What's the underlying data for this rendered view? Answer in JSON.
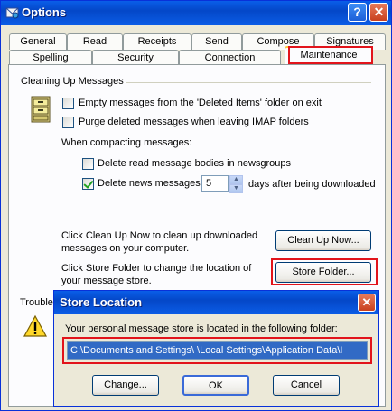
{
  "window": {
    "title": "Options",
    "help_label": "?",
    "close_label": "✕"
  },
  "tabs_row1": [
    "General",
    "Read",
    "Receipts",
    "Send",
    "Compose",
    "Signatures"
  ],
  "tabs_row2": [
    "Spelling",
    "Security",
    "Connection",
    "Maintenance"
  ],
  "selected_tab": "Maintenance",
  "cleanup": {
    "group_label": "Cleaning Up Messages",
    "empty_deleted": {
      "label": "Empty messages from the 'Deleted Items' folder on exit",
      "checked": false
    },
    "purge_imap": {
      "label": "Purge deleted messages when leaving IMAP folders",
      "checked": false
    },
    "compacting_label": "When compacting messages:",
    "delete_read_bodies": {
      "label": "Delete read message bodies in newsgroups",
      "checked": false
    },
    "delete_news": {
      "label": "Delete news messages",
      "checked": true
    },
    "days_value": "5",
    "days_suffix": "days after being downloaded",
    "clean_desc": "Click Clean Up Now to clean up downloaded messages on your computer.",
    "clean_button": "Clean Up Now...",
    "store_desc": "Click Store Folder to change the location of your message store.",
    "store_button": "Store Folder...",
    "trouble_label": "Trouble"
  },
  "dialog": {
    "title": "Store Location",
    "close_label": "✕",
    "message": "Your personal message store is located in the following folder:",
    "path": "C:\\Documents and Settings\\           \\Local Settings\\Application Data\\I",
    "change_button": "Change...",
    "ok_button": "OK",
    "cancel_button": "Cancel"
  },
  "colors": {
    "highlight_border": "#e2141b",
    "titlebar": "#0447c8",
    "selection": "#316ac5"
  }
}
